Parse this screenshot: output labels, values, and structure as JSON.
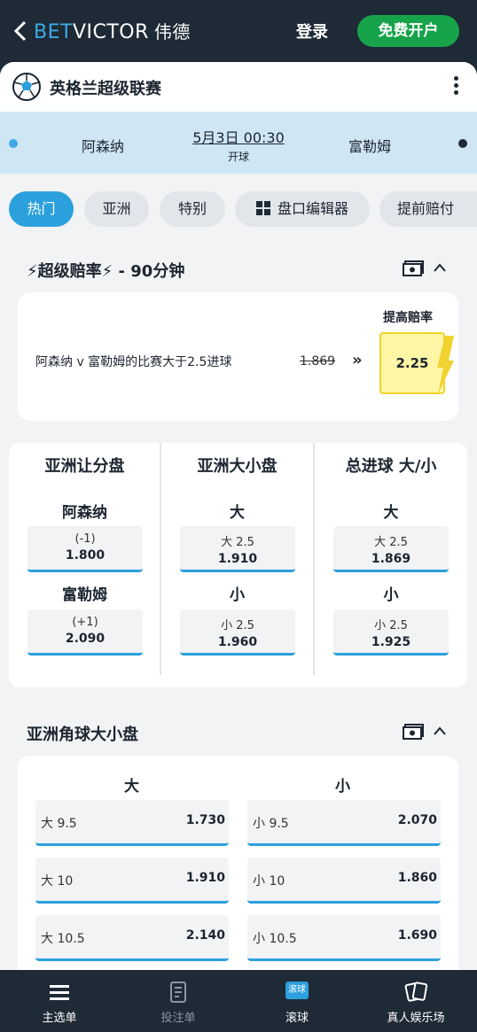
{
  "header": {
    "brand_bet": "BET",
    "brand_victor": "VICTOR",
    "brand_cn": "伟德",
    "login": "登录",
    "signup": "免费开户"
  },
  "league": {
    "name": "英格兰超级联赛"
  },
  "match": {
    "home": "阿森纳",
    "away": "富勒姆",
    "kickoff": "5月3日 00:30",
    "kickoff_label": "开球"
  },
  "tabs": [
    "热门",
    "亚洲",
    "特别",
    "盘口编辑器",
    "提前赔付"
  ],
  "boost_section": {
    "title": "⚡超级赔率⚡ - 90分钟",
    "description": "阿森纳 v 富勒姆的比赛大于2.5进球",
    "old_odds": "1.869",
    "arrows": "»",
    "boost_label": "提高赔率",
    "new_odds": "2.25"
  },
  "markets": [
    {
      "title": "亚洲让分盘",
      "rows": [
        {
          "header": "阿森纳",
          "line": "(-1)",
          "odds": "1.800"
        },
        {
          "header": "富勒姆",
          "line": "(+1)",
          "odds": "2.090"
        }
      ]
    },
    {
      "title": "亚洲大小盘",
      "rows": [
        {
          "header": "大",
          "line": "大 2.5",
          "odds": "1.910"
        },
        {
          "header": "小",
          "line": "小 2.5",
          "odds": "1.960"
        }
      ]
    },
    {
      "title": "总进球 大/小",
      "rows": [
        {
          "header": "大",
          "line": "大 2.5",
          "odds": "1.869"
        },
        {
          "header": "小",
          "line": "小 2.5",
          "odds": "1.925"
        }
      ]
    }
  ],
  "corners": {
    "title": "亚洲角球大小盘",
    "over_header": "大",
    "under_header": "小",
    "rows": [
      {
        "over_line": "大 9.5",
        "over_odds": "1.730",
        "under_line": "小 9.5",
        "under_odds": "2.070"
      },
      {
        "over_line": "大 10",
        "over_odds": "1.910",
        "under_line": "小 10",
        "under_odds": "1.860"
      },
      {
        "over_line": "大 10.5",
        "over_odds": "2.140",
        "under_line": "小 10.5",
        "under_odds": "1.690"
      }
    ]
  },
  "bottom_nav": {
    "items": [
      {
        "label": "主选单",
        "icon": "menu-icon"
      },
      {
        "label": "投注单",
        "icon": "betslip-icon"
      },
      {
        "label": "滚球",
        "icon": "live-icon",
        "badge": "滚球"
      },
      {
        "label": "真人娱乐场",
        "icon": "cards-icon"
      }
    ]
  },
  "colors": {
    "accent": "#2ba0dc",
    "brand_dark": "#1e2a36",
    "signup_green": "#17a34a",
    "boost_yellow": "#fff7a6"
  }
}
